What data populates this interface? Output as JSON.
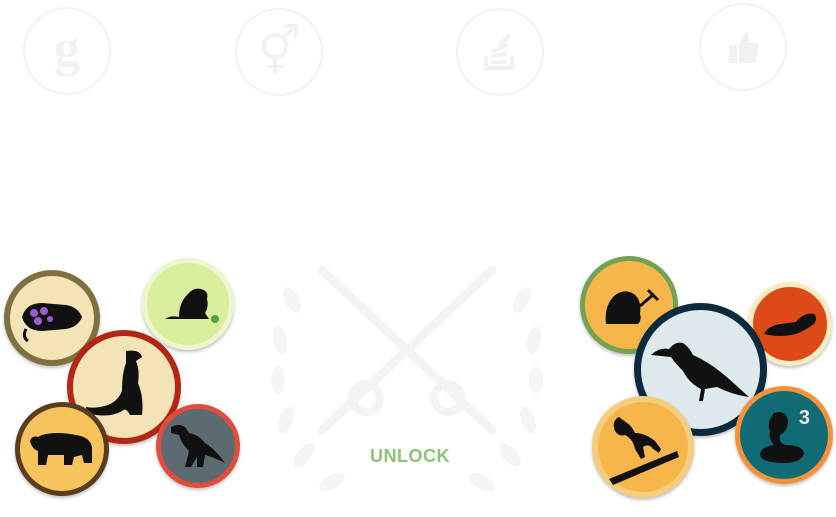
{
  "top_icons": [
    {
      "name": "google-icon",
      "glyph": "g"
    },
    {
      "name": "gender-symbol-icon",
      "glyph": "⚥"
    },
    {
      "name": "stack-overflow-icon",
      "glyph": ""
    },
    {
      "name": "thumbs-up-icon",
      "glyph": ""
    }
  ],
  "left_badges": [
    {
      "name": "trilobite-badge-icon",
      "bg": "#f4e3b6",
      "ring": "#7f7040"
    },
    {
      "name": "prairie-dog-badge-icon",
      "bg": "#d9ee9c",
      "ring": "#eef6cf"
    },
    {
      "name": "meerkat-badge-icon",
      "bg": "#f4e3b6",
      "ring": "#b32616"
    },
    {
      "name": "bear-badge-icon",
      "bg": "#f6c35d",
      "ring": "#5a3d1f"
    },
    {
      "name": "trex-badge-icon",
      "bg": "#5c6a71",
      "ring": "#e24c3c"
    }
  ],
  "right_badges": [
    {
      "name": "mole-badge-icon",
      "bg": "#f6b64b",
      "ring": "#72a352"
    },
    {
      "name": "seal-badge-icon",
      "bg": "#dd4a17",
      "ring": "#f7ecc2"
    },
    {
      "name": "crow-badge-icon",
      "bg": "#dde9ec",
      "ring": "#0c2a3e"
    },
    {
      "name": "monkey-badge-icon",
      "bg": "#f6b64b",
      "ring": "#f4cd7d"
    },
    {
      "name": "cobra-badge-icon",
      "bg": "#106b74",
      "ring": "#f4923a",
      "count": "3"
    }
  ],
  "unlock": {
    "label": "UNLOCK",
    "color": "#8bc474"
  }
}
